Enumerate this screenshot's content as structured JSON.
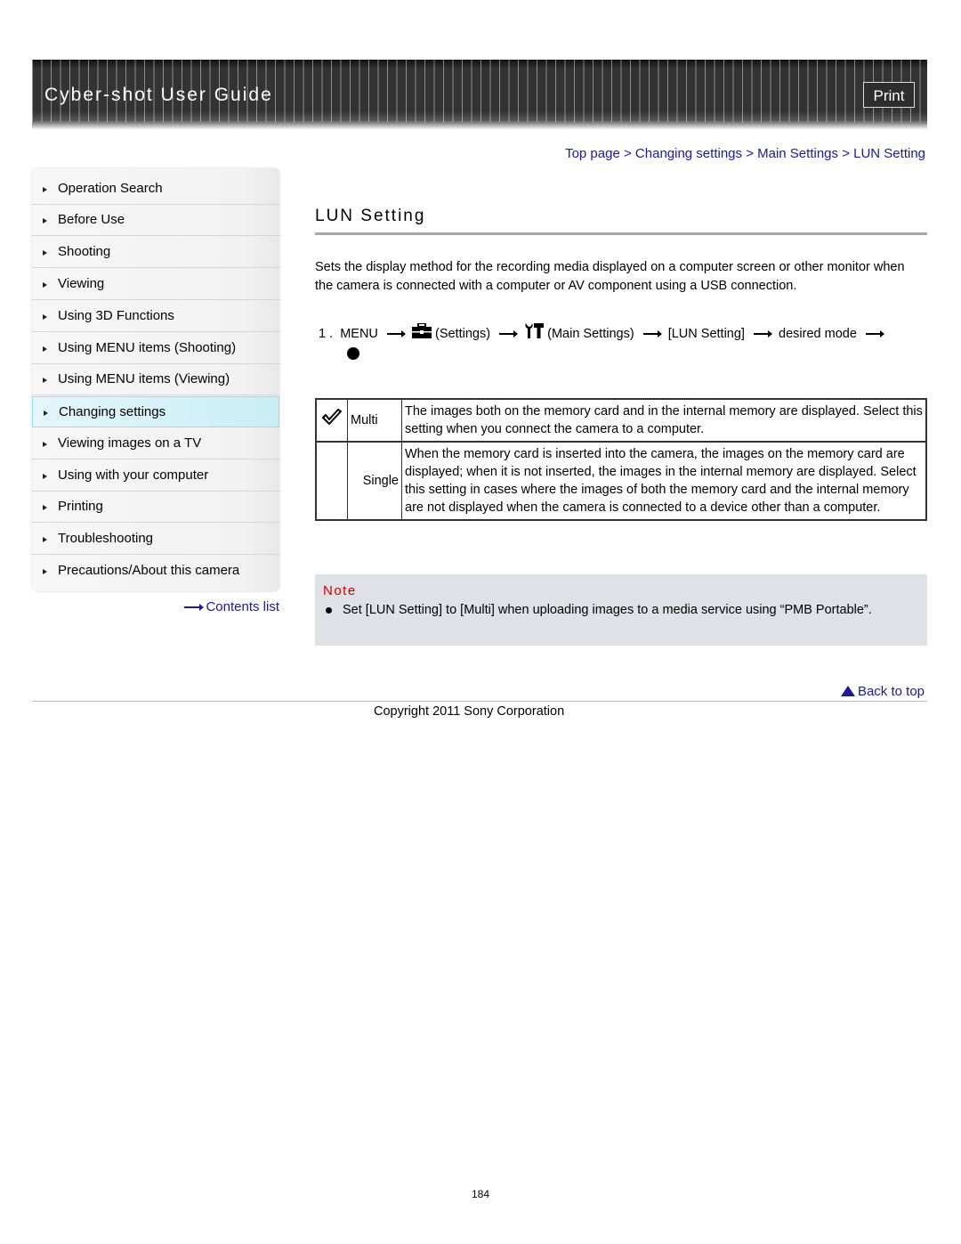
{
  "header": {
    "title": "Cyber-shot User Guide",
    "print_label": "Print"
  },
  "sidebar": {
    "items": [
      {
        "label": "Operation Search"
      },
      {
        "label": "Before Use"
      },
      {
        "label": "Shooting"
      },
      {
        "label": "Viewing"
      },
      {
        "label": "Using 3D Functions"
      },
      {
        "label": "Using MENU items (Shooting)"
      },
      {
        "label": "Using MENU items (Viewing)"
      },
      {
        "label": "Changing settings",
        "active": true
      },
      {
        "label": "Viewing images on a TV"
      },
      {
        "label": "Using with your computer"
      },
      {
        "label": "Printing"
      },
      {
        "label": "Troubleshooting"
      },
      {
        "label": "Precautions/About this camera"
      }
    ],
    "contents_link": "Contents list"
  },
  "breadcrumb": {
    "items": [
      "Top page",
      "Changing settings",
      "Main Settings",
      "LUN Setting"
    ],
    "separator": ">"
  },
  "page": {
    "title": "LUN Setting",
    "intro": "Sets the display method for the recording media displayed on a computer screen or other monitor when the camera is connected with a computer or AV component using a USB connection.",
    "step": {
      "number": "1 .",
      "menu": "MENU",
      "settings_icon": "toolbox-icon",
      "settings": "(Settings)",
      "main_icon": "wrench-hammer-icon",
      "main_settings": "(Main Settings)",
      "lun": "[LUN Setting]",
      "desired": "desired mode",
      "end_icon": "center-button-dot-icon"
    }
  },
  "modes": [
    {
      "icon": "checkmark-icon",
      "name": "Multi",
      "description": "The images both on the memory card and in the internal memory are displayed. Select this setting when you connect the camera to a computer."
    },
    {
      "icon": "",
      "name": "Single",
      "description": "When the memory card is inserted into the camera, the images on the memory card are displayed; when it is not inserted, the images in the internal memory are displayed. Select this setting in cases where the images of both the memory card and the internal memory are not displayed when the camera is connected to a device other than a computer."
    }
  ],
  "note": {
    "title": "Note",
    "text": "Set [LUN Setting] to [Multi] when uploading images to a media service using “PMB Portable”."
  },
  "footer": {
    "back_to_top": "Back to top",
    "copyright": "Copyright 2011 Sony Corporation",
    "page_number": "184"
  },
  "colors": {
    "link": "#1a1a9a",
    "note_title": "#cc0000",
    "note_bg": "#dfe1e6",
    "active_nav": "#c9edf5"
  }
}
